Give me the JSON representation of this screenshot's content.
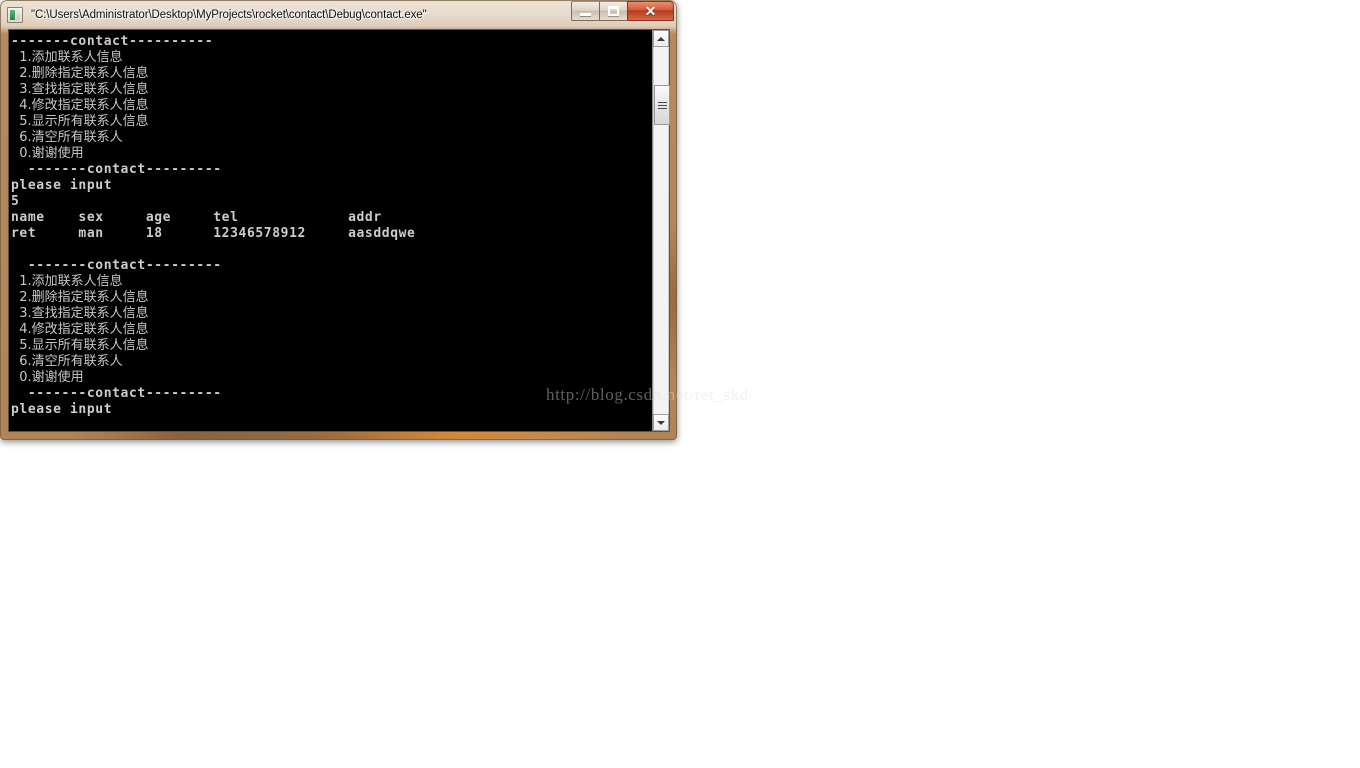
{
  "window": {
    "title": "\"C:\\Users\\Administrator\\Desktop\\MyProjects\\rocket\\contact\\Debug\\contact.exe\"",
    "icon": "console-app-icon",
    "buttons": {
      "minimize_label": "–",
      "maximize_label": "□",
      "close_label": "✕"
    }
  },
  "console": {
    "lines": [
      {
        "text": "-------contact----------",
        "style": "ascii"
      },
      {
        "text": "  1.添加联系人信息",
        "style": "cjk"
      },
      {
        "text": "  2.删除指定联系人信息",
        "style": "cjk"
      },
      {
        "text": "  3.查找指定联系人信息",
        "style": "cjk"
      },
      {
        "text": "  4.修改指定联系人信息",
        "style": "cjk"
      },
      {
        "text": "  5.显示所有联系人信息",
        "style": "cjk"
      },
      {
        "text": "  6.清空所有联系人",
        "style": "cjk"
      },
      {
        "text": "  0.谢谢使用",
        "style": "cjk"
      },
      {
        "text": "  -------contact---------",
        "style": "ascii"
      },
      {
        "text": "please input",
        "style": "ascii"
      },
      {
        "text": "5",
        "style": "ascii"
      },
      {
        "text": "name    sex     age     tel             addr",
        "style": "ascii"
      },
      {
        "text": "ret     man     18      12346578912     aasddqwe",
        "style": "ascii"
      },
      {
        "text": "",
        "style": "blank"
      },
      {
        "text": "  -------contact---------",
        "style": "ascii"
      },
      {
        "text": "  1.添加联系人信息",
        "style": "cjk"
      },
      {
        "text": "  2.删除指定联系人信息",
        "style": "cjk"
      },
      {
        "text": "  3.查找指定联系人信息",
        "style": "cjk"
      },
      {
        "text": "  4.修改指定联系人信息",
        "style": "cjk"
      },
      {
        "text": "  5.显示所有联系人信息",
        "style": "cjk"
      },
      {
        "text": "  6.清空所有联系人",
        "style": "cjk"
      },
      {
        "text": "  0.谢谢使用",
        "style": "cjk"
      },
      {
        "text": "  -------contact---------",
        "style": "ascii"
      },
      {
        "text": "please input",
        "style": "ascii"
      }
    ],
    "table": {
      "headers": [
        "name",
        "sex",
        "age",
        "tel",
        "addr"
      ],
      "rows": [
        [
          "ret",
          "man",
          "18",
          "12346578912",
          "aasddqwe"
        ]
      ]
    },
    "menu_options": [
      {
        "key": "1",
        "label": "添加联系人信息"
      },
      {
        "key": "2",
        "label": "删除指定联系人信息"
      },
      {
        "key": "3",
        "label": "查找指定联系人信息"
      },
      {
        "key": "4",
        "label": "修改指定联系人信息"
      },
      {
        "key": "5",
        "label": "显示所有联系人信息"
      },
      {
        "key": "6",
        "label": "清空所有联系人"
      },
      {
        "key": "0",
        "label": "谢谢使用"
      }
    ],
    "prompt": "please input",
    "user_input": "5",
    "banner": "-------contact----------",
    "text_color": "#c8c8c8",
    "background_color": "#000000"
  },
  "scrollbar": {
    "up_arrow": "scroll-up-arrow",
    "down_arrow": "scroll-down-arrow"
  },
  "watermark": {
    "text": "http://blog.csdn.net/ret_skd"
  }
}
